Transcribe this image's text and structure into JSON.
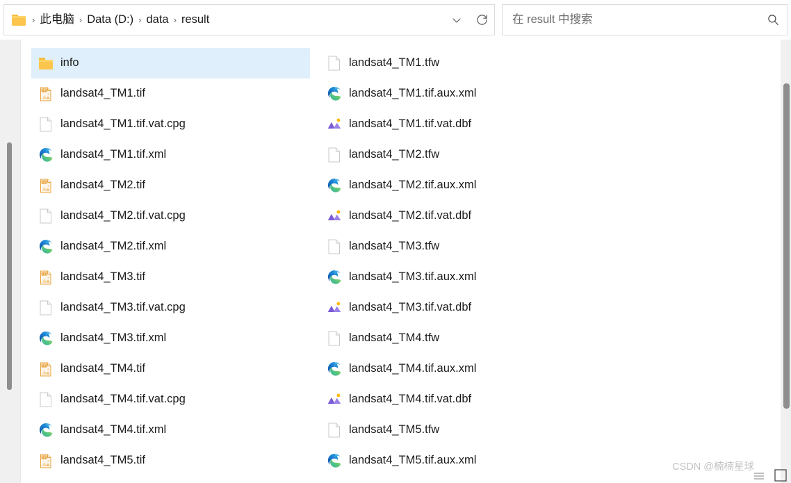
{
  "window": {
    "type": "windows-file-explorer",
    "accent_selection_color": "#dfeffb"
  },
  "address_bar": {
    "folder_icon": "folder-icon",
    "breadcrumbs": [
      "此电脑",
      "Data (D:)",
      "data",
      "result"
    ],
    "separator": "›",
    "history_dropdown_icon": "chevron-down-icon",
    "refresh_icon": "refresh-icon"
  },
  "search": {
    "placeholder": "在 result 中搜索",
    "value": "",
    "icon": "search-icon"
  },
  "file_list": {
    "columns": [
      {
        "items": [
          {
            "name": "info",
            "icon": "folder-icon",
            "selected": true
          },
          {
            "name": "landsat4_TM1.tif",
            "icon": "tif-image-icon",
            "selected": false
          },
          {
            "name": "landsat4_TM1.tif.vat.cpg",
            "icon": "blank-document-icon",
            "selected": false
          },
          {
            "name": "landsat4_TM1.tif.xml",
            "icon": "edge-browser-icon",
            "selected": false
          },
          {
            "name": "landsat4_TM2.tif",
            "icon": "tif-image-icon",
            "selected": false
          },
          {
            "name": "landsat4_TM2.tif.vat.cpg",
            "icon": "blank-document-icon",
            "selected": false
          },
          {
            "name": "landsat4_TM2.tif.xml",
            "icon": "edge-browser-icon",
            "selected": false
          },
          {
            "name": "landsat4_TM3.tif",
            "icon": "tif-image-icon",
            "selected": false
          },
          {
            "name": "landsat4_TM3.tif.vat.cpg",
            "icon": "blank-document-icon",
            "selected": false
          },
          {
            "name": "landsat4_TM3.tif.xml",
            "icon": "edge-browser-icon",
            "selected": false
          },
          {
            "name": "landsat4_TM4.tif",
            "icon": "tif-image-icon",
            "selected": false
          },
          {
            "name": "landsat4_TM4.tif.vat.cpg",
            "icon": "blank-document-icon",
            "selected": false
          },
          {
            "name": "landsat4_TM4.tif.xml",
            "icon": "edge-browser-icon",
            "selected": false
          },
          {
            "name": "landsat4_TM5.tif",
            "icon": "tif-image-icon",
            "selected": false
          }
        ]
      },
      {
        "items": [
          {
            "name": "landsat4_TM1.tfw",
            "icon": "blank-document-icon",
            "selected": false
          },
          {
            "name": "landsat4_TM1.tif.aux.xml",
            "icon": "edge-browser-icon",
            "selected": false
          },
          {
            "name": "landsat4_TM1.tif.vat.dbf",
            "icon": "dbf-photos-icon",
            "selected": false
          },
          {
            "name": "landsat4_TM2.tfw",
            "icon": "blank-document-icon",
            "selected": false
          },
          {
            "name": "landsat4_TM2.tif.aux.xml",
            "icon": "edge-browser-icon",
            "selected": false
          },
          {
            "name": "landsat4_TM2.tif.vat.dbf",
            "icon": "dbf-photos-icon",
            "selected": false
          },
          {
            "name": "landsat4_TM3.tfw",
            "icon": "blank-document-icon",
            "selected": false
          },
          {
            "name": "landsat4_TM3.tif.aux.xml",
            "icon": "edge-browser-icon",
            "selected": false
          },
          {
            "name": "landsat4_TM3.tif.vat.dbf",
            "icon": "dbf-photos-icon",
            "selected": false
          },
          {
            "name": "landsat4_TM4.tfw",
            "icon": "blank-document-icon",
            "selected": false
          },
          {
            "name": "landsat4_TM4.tif.aux.xml",
            "icon": "edge-browser-icon",
            "selected": false
          },
          {
            "name": "landsat4_TM4.tif.vat.dbf",
            "icon": "dbf-photos-icon",
            "selected": false
          },
          {
            "name": "landsat4_TM5.tfw",
            "icon": "blank-document-icon",
            "selected": false
          },
          {
            "name": "landsat4_TM5.tif.aux.xml",
            "icon": "edge-browser-icon",
            "selected": false
          }
        ]
      }
    ]
  },
  "status_bar": {
    "view_details_icon": "details-view-icon",
    "view_large_icons_icon": "large-icons-view-icon"
  },
  "watermark": {
    "text": "CSDN @楠楠星球"
  }
}
